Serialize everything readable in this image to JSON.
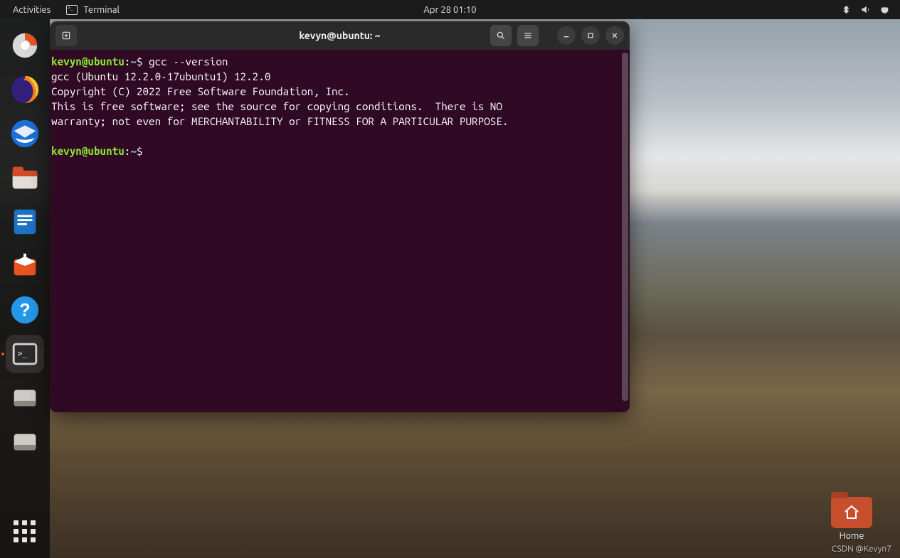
{
  "topbar": {
    "activities": "Activities",
    "app_name": "Terminal",
    "clock": "Apr 28  01:10"
  },
  "dock": {
    "items": [
      {
        "name": "installer-icon"
      },
      {
        "name": "firefox-icon"
      },
      {
        "name": "thunderbird-icon"
      },
      {
        "name": "files-icon"
      },
      {
        "name": "writer-icon"
      },
      {
        "name": "software-icon"
      },
      {
        "name": "help-icon"
      },
      {
        "name": "terminal-icon"
      },
      {
        "name": "disk-icon-1"
      },
      {
        "name": "disk-icon-2"
      }
    ]
  },
  "terminal": {
    "title": "kevyn@ubuntu: ~",
    "prompt_user": "kevyn@ubuntu",
    "prompt_path": "~",
    "prompt_symbol": "$",
    "command1": "gcc --version",
    "out_line1": "gcc (Ubuntu 12.2.0-17ubuntu1) 12.2.0",
    "out_line2": "Copyright (C) 2022 Free Software Foundation, Inc.",
    "out_line3": "This is free software; see the source for copying conditions.  There is NO",
    "out_line4": "warranty; not even for MERCHANTABILITY or FITNESS FOR A PARTICULAR PURPOSE."
  },
  "desktop": {
    "home_label": "Home"
  },
  "watermark": "CSDN @Kevyn7"
}
